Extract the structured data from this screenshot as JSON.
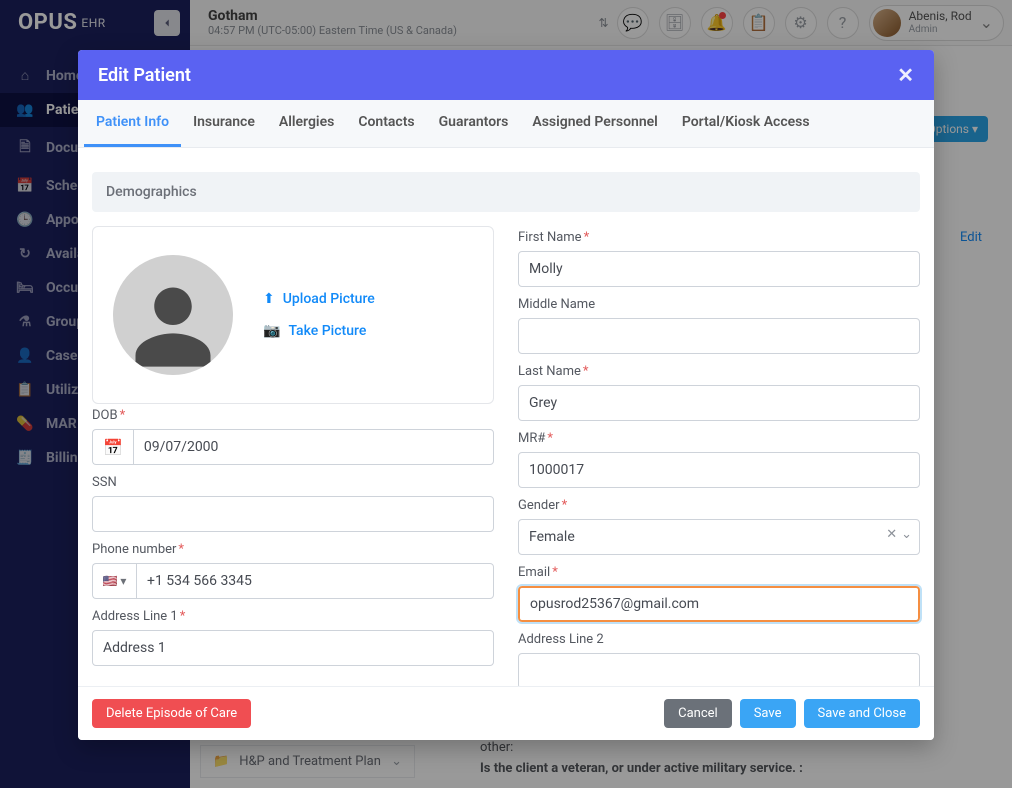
{
  "brand": {
    "name": "OPUS",
    "suffix": "EHR"
  },
  "topbar": {
    "location_name": "Gotham",
    "location_tz": "04:57 PM (UTC-05:00) Eastern Time (US & Canada)",
    "user_name": "Abenis, Rod",
    "user_role": "Admin"
  },
  "sidebar": {
    "items": [
      {
        "icon": "⌂",
        "label": "Home"
      },
      {
        "icon": "👥",
        "label": "Patients"
      },
      {
        "icon": "🗎",
        "label": "Documents"
      },
      {
        "icon": "📅",
        "label": "Schedule"
      },
      {
        "icon": "🕒",
        "label": "Appointments"
      },
      {
        "icon": "↻",
        "label": "Availability"
      },
      {
        "icon": "🛏",
        "label": "Occupancy"
      },
      {
        "icon": "⚗",
        "label": "Groups"
      },
      {
        "icon": "👤",
        "label": "Cases"
      },
      {
        "icon": "📋",
        "label": "Utilization"
      },
      {
        "icon": "💊",
        "label": "MAR"
      },
      {
        "icon": "🧾",
        "label": "Billing"
      }
    ],
    "active_index": 1
  },
  "background": {
    "options_label": "Options ▾",
    "edit_label": "Edit",
    "facesheet_item": "H&P and Treatment Plan",
    "bg_line1": "other:",
    "bg_line2": "Is the client a veteran, or under active military service. :"
  },
  "modal": {
    "title": "Edit Patient",
    "tabs": [
      "Patient Info",
      "Insurance",
      "Allergies",
      "Contacts",
      "Guarantors",
      "Assigned Personnel",
      "Portal/Kiosk Access"
    ],
    "active_tab": 0,
    "section_label": "Demographics",
    "photo": {
      "upload_label": "Upload Picture",
      "take_label": "Take Picture"
    },
    "fields": {
      "dob": {
        "label": "DOB",
        "value": "09/07/2000"
      },
      "ssn": {
        "label": "SSN",
        "value": ""
      },
      "phone": {
        "label": "Phone number",
        "value": "+1 534 566 3345"
      },
      "addr1": {
        "label": "Address Line 1",
        "value": "Address 1"
      },
      "first_name": {
        "label": "First Name",
        "value": "Molly"
      },
      "middle_name": {
        "label": "Middle Name",
        "value": ""
      },
      "last_name": {
        "label": "Last Name",
        "value": "Grey"
      },
      "mr": {
        "label": "MR#",
        "value": "1000017"
      },
      "gender": {
        "label": "Gender",
        "value": "Female"
      },
      "email": {
        "label": "Email",
        "value": "opusrod25367@gmail.com"
      },
      "addr2": {
        "label": "Address Line 2",
        "value": ""
      }
    },
    "footer": {
      "delete_label": "Delete Episode of Care",
      "cancel_label": "Cancel",
      "save_label": "Save",
      "save_close_label": "Save and Close"
    }
  }
}
